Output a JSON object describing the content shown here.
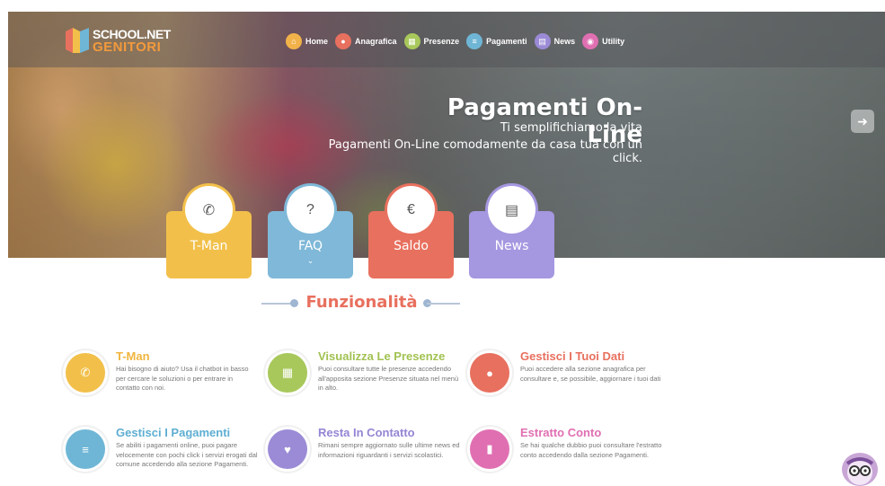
{
  "brand": {
    "line1": "SCHOOL.NET",
    "line2": "GENITORI"
  },
  "nav": [
    {
      "label": "Home",
      "icon": "home-icon",
      "color": "#f2b24a",
      "glyph": "⌂"
    },
    {
      "label": "Anagrafica",
      "icon": "user-icon",
      "color": "#e8705e",
      "glyph": "●"
    },
    {
      "label": "Presenze",
      "icon": "calendar-icon",
      "color": "#a8c85b",
      "glyph": "▦"
    },
    {
      "label": "Pagamenti",
      "icon": "list-icon",
      "color": "#6fb6d6",
      "glyph": "≡"
    },
    {
      "label": "News",
      "icon": "newspaper-icon",
      "color": "#9b8bd6",
      "glyph": "▤"
    },
    {
      "label": "Utility",
      "icon": "eye-icon",
      "color": "#e06fb2",
      "glyph": "◉"
    }
  ],
  "hero": {
    "title": "Pagamenti On-Line",
    "subtitle": "Ti semplifichiamo la vita",
    "description": "Pagamenti On-Line comodamente da casa tua con un click."
  },
  "cards": [
    {
      "label": "T-Man",
      "icon": "phone-icon",
      "color": "#f2c04a",
      "ring": "#f2c04a",
      "glyph": "✆",
      "chevron": ""
    },
    {
      "label": "FAQ",
      "icon": "question-icon",
      "color": "#7fb8d8",
      "ring": "#7fb8d8",
      "glyph": "?",
      "chevron": "⌄"
    },
    {
      "label": "Saldo",
      "icon": "euro-icon",
      "color": "#e8705e",
      "ring": "#e8705e",
      "glyph": "€",
      "chevron": ""
    },
    {
      "label": "News",
      "icon": "newspaper-icon",
      "color": "#a597e0",
      "ring": "#a597e0",
      "glyph": "▤",
      "chevron": ""
    }
  ],
  "section_title": "Funzionalità",
  "features": [
    {
      "title": "T-Man",
      "title_color": "#f0b53e",
      "icon": "phone-icon",
      "color": "#f2c04a",
      "glyph": "✆",
      "desc": "Hai bisogno di aiuto? Usa il chatbot in basso per cercare le soluzioni o per entrare in contatto con noi."
    },
    {
      "title": "Visualizza Le Presenze",
      "title_color": "#a2c252",
      "icon": "calendar-icon",
      "color": "#a8c85b",
      "glyph": "▦",
      "desc": "Puoi consultare tutte le presenze accedendo all'apposita sezione Presenze situata nel menù in alto."
    },
    {
      "title": "Gestisci I Tuoi Dati",
      "title_color": "#e8705e",
      "icon": "user-icon",
      "color": "#e8705e",
      "glyph": "●",
      "desc": "Puoi accedere alla sezione anagrafica per consultare e, se possibile, aggiornare i tuoi dati"
    },
    {
      "title": "Gestisci I Pagamenti",
      "title_color": "#5eaed2",
      "icon": "list-icon",
      "color": "#6fb6d6",
      "glyph": "≡",
      "desc": "Se abiliti i pagamenti online, puoi pagare velocemente con pochi click i servizi erogati dal comune accedendo alla sezione Pagamenti."
    },
    {
      "title": "Resta In Contatto",
      "title_color": "#9585d4",
      "icon": "heart-icon",
      "color": "#9b8bd6",
      "glyph": "♥",
      "desc": "Rimani sempre aggiornato sulle ultime news ed informazioni riguardanti i servizi scolastici."
    },
    {
      "title": "Estratto Conto",
      "title_color": "#e06fb2",
      "icon": "document-icon",
      "color": "#e06fb2",
      "glyph": "▮",
      "desc": "Se hai qualche dubbio puoi consultare l'estratto conto accedendo dalla sezione Pagamenti."
    }
  ]
}
